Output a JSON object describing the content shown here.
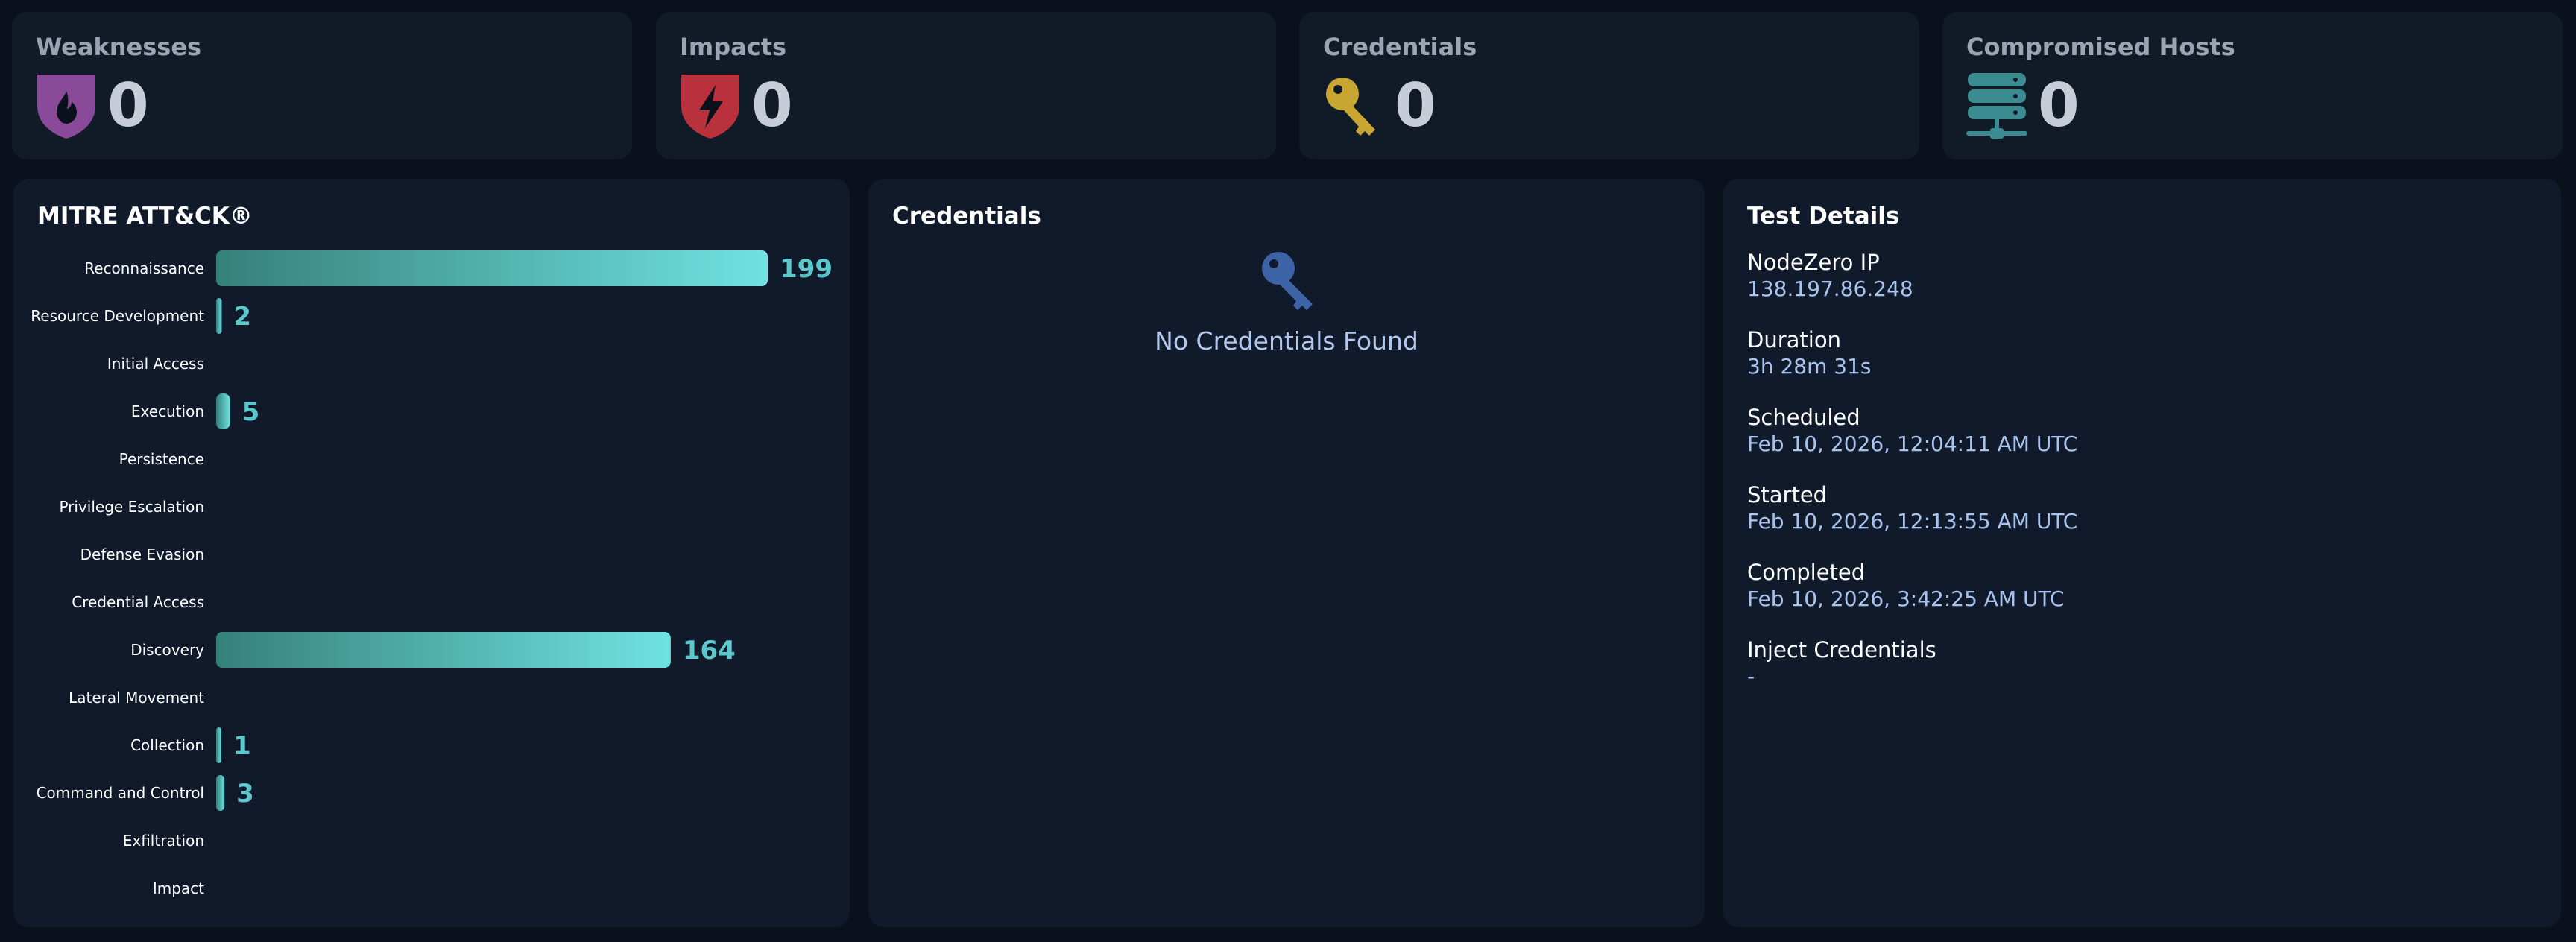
{
  "stats": [
    {
      "title": "Weaknesses",
      "value": "0",
      "icon": "shield-flame-icon",
      "color": "#8a4a9a"
    },
    {
      "title": "Impacts",
      "value": "0",
      "icon": "shield-bolt-icon",
      "color": "#b8313d"
    },
    {
      "title": "Credentials",
      "value": "0",
      "icon": "key-icon",
      "color": "#c9a532"
    },
    {
      "title": "Compromised Hosts",
      "value": "0",
      "icon": "server-icon",
      "color": "#3a8c91"
    }
  ],
  "mitre": {
    "title": "MITRE ATT&CK®"
  },
  "chart_data": {
    "type": "bar",
    "orientation": "horizontal",
    "categories": [
      "Reconnaissance",
      "Resource Development",
      "Initial Access",
      "Execution",
      "Persistence",
      "Privilege Escalation",
      "Defense Evasion",
      "Credential Access",
      "Discovery",
      "Lateral Movement",
      "Collection",
      "Command and Control",
      "Exfiltration",
      "Impact"
    ],
    "values": [
      199,
      2,
      null,
      5,
      null,
      null,
      null,
      null,
      164,
      null,
      1,
      3,
      null,
      null
    ],
    "max": 199,
    "bar_color_start": "#36807b",
    "bar_color_end": "#6fe3e1",
    "label_color": "#5cc8cc"
  },
  "credentials_panel": {
    "title": "Credentials",
    "empty_text": "No Credentials Found",
    "icon": "key-icon",
    "icon_color": "#3d63a7"
  },
  "test_details": {
    "title": "Test Details",
    "items": [
      {
        "label": "NodeZero IP",
        "value": "138.197.86.248"
      },
      {
        "label": "Duration",
        "value": "3h 28m 31s"
      },
      {
        "label": "Scheduled",
        "value": "Feb 10, 2026, 12:04:11 AM UTC"
      },
      {
        "label": "Started",
        "value": "Feb 10, 2026, 12:13:55 AM UTC"
      },
      {
        "label": "Completed",
        "value": "Feb 10, 2026, 3:42:25 AM UTC"
      },
      {
        "label": "Inject Credentials",
        "value": "-"
      }
    ]
  }
}
